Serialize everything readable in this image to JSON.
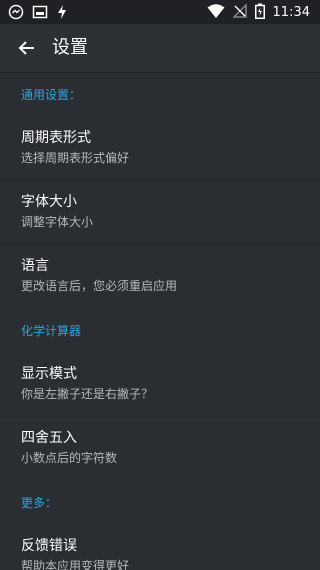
{
  "status_bar": {
    "time": "11:34",
    "icons": [
      "notification-icon",
      "image-icon",
      "flash-icon",
      "wifi-icon",
      "no-signal-icon",
      "battery-charging-icon"
    ]
  },
  "app_bar": {
    "title": "设置",
    "back_icon": "arrow-left-icon"
  },
  "sections": [
    {
      "header": "通用设置：",
      "items": [
        {
          "title": "周期表形式",
          "summary": "选择周期表形式偏好"
        },
        {
          "title": "字体大小",
          "summary": "调整字体大小"
        },
        {
          "title": "语言",
          "summary": "更改语言后，您必须重启应用"
        }
      ]
    },
    {
      "header": "化学计算器",
      "items": [
        {
          "title": "显示模式",
          "summary": "你是左撇子还是右撇子？"
        },
        {
          "title": "四舍五入",
          "summary": "小数点后的字符数"
        }
      ]
    },
    {
      "header": "更多：",
      "items": [
        {
          "title": "反馈错误",
          "summary": "帮助本应用变得更好"
        }
      ]
    }
  ],
  "colors": {
    "background": "#2a2d31",
    "accent": "#2aa6e0",
    "statusbar": "#1f2124",
    "appbar": "#2d3034"
  }
}
